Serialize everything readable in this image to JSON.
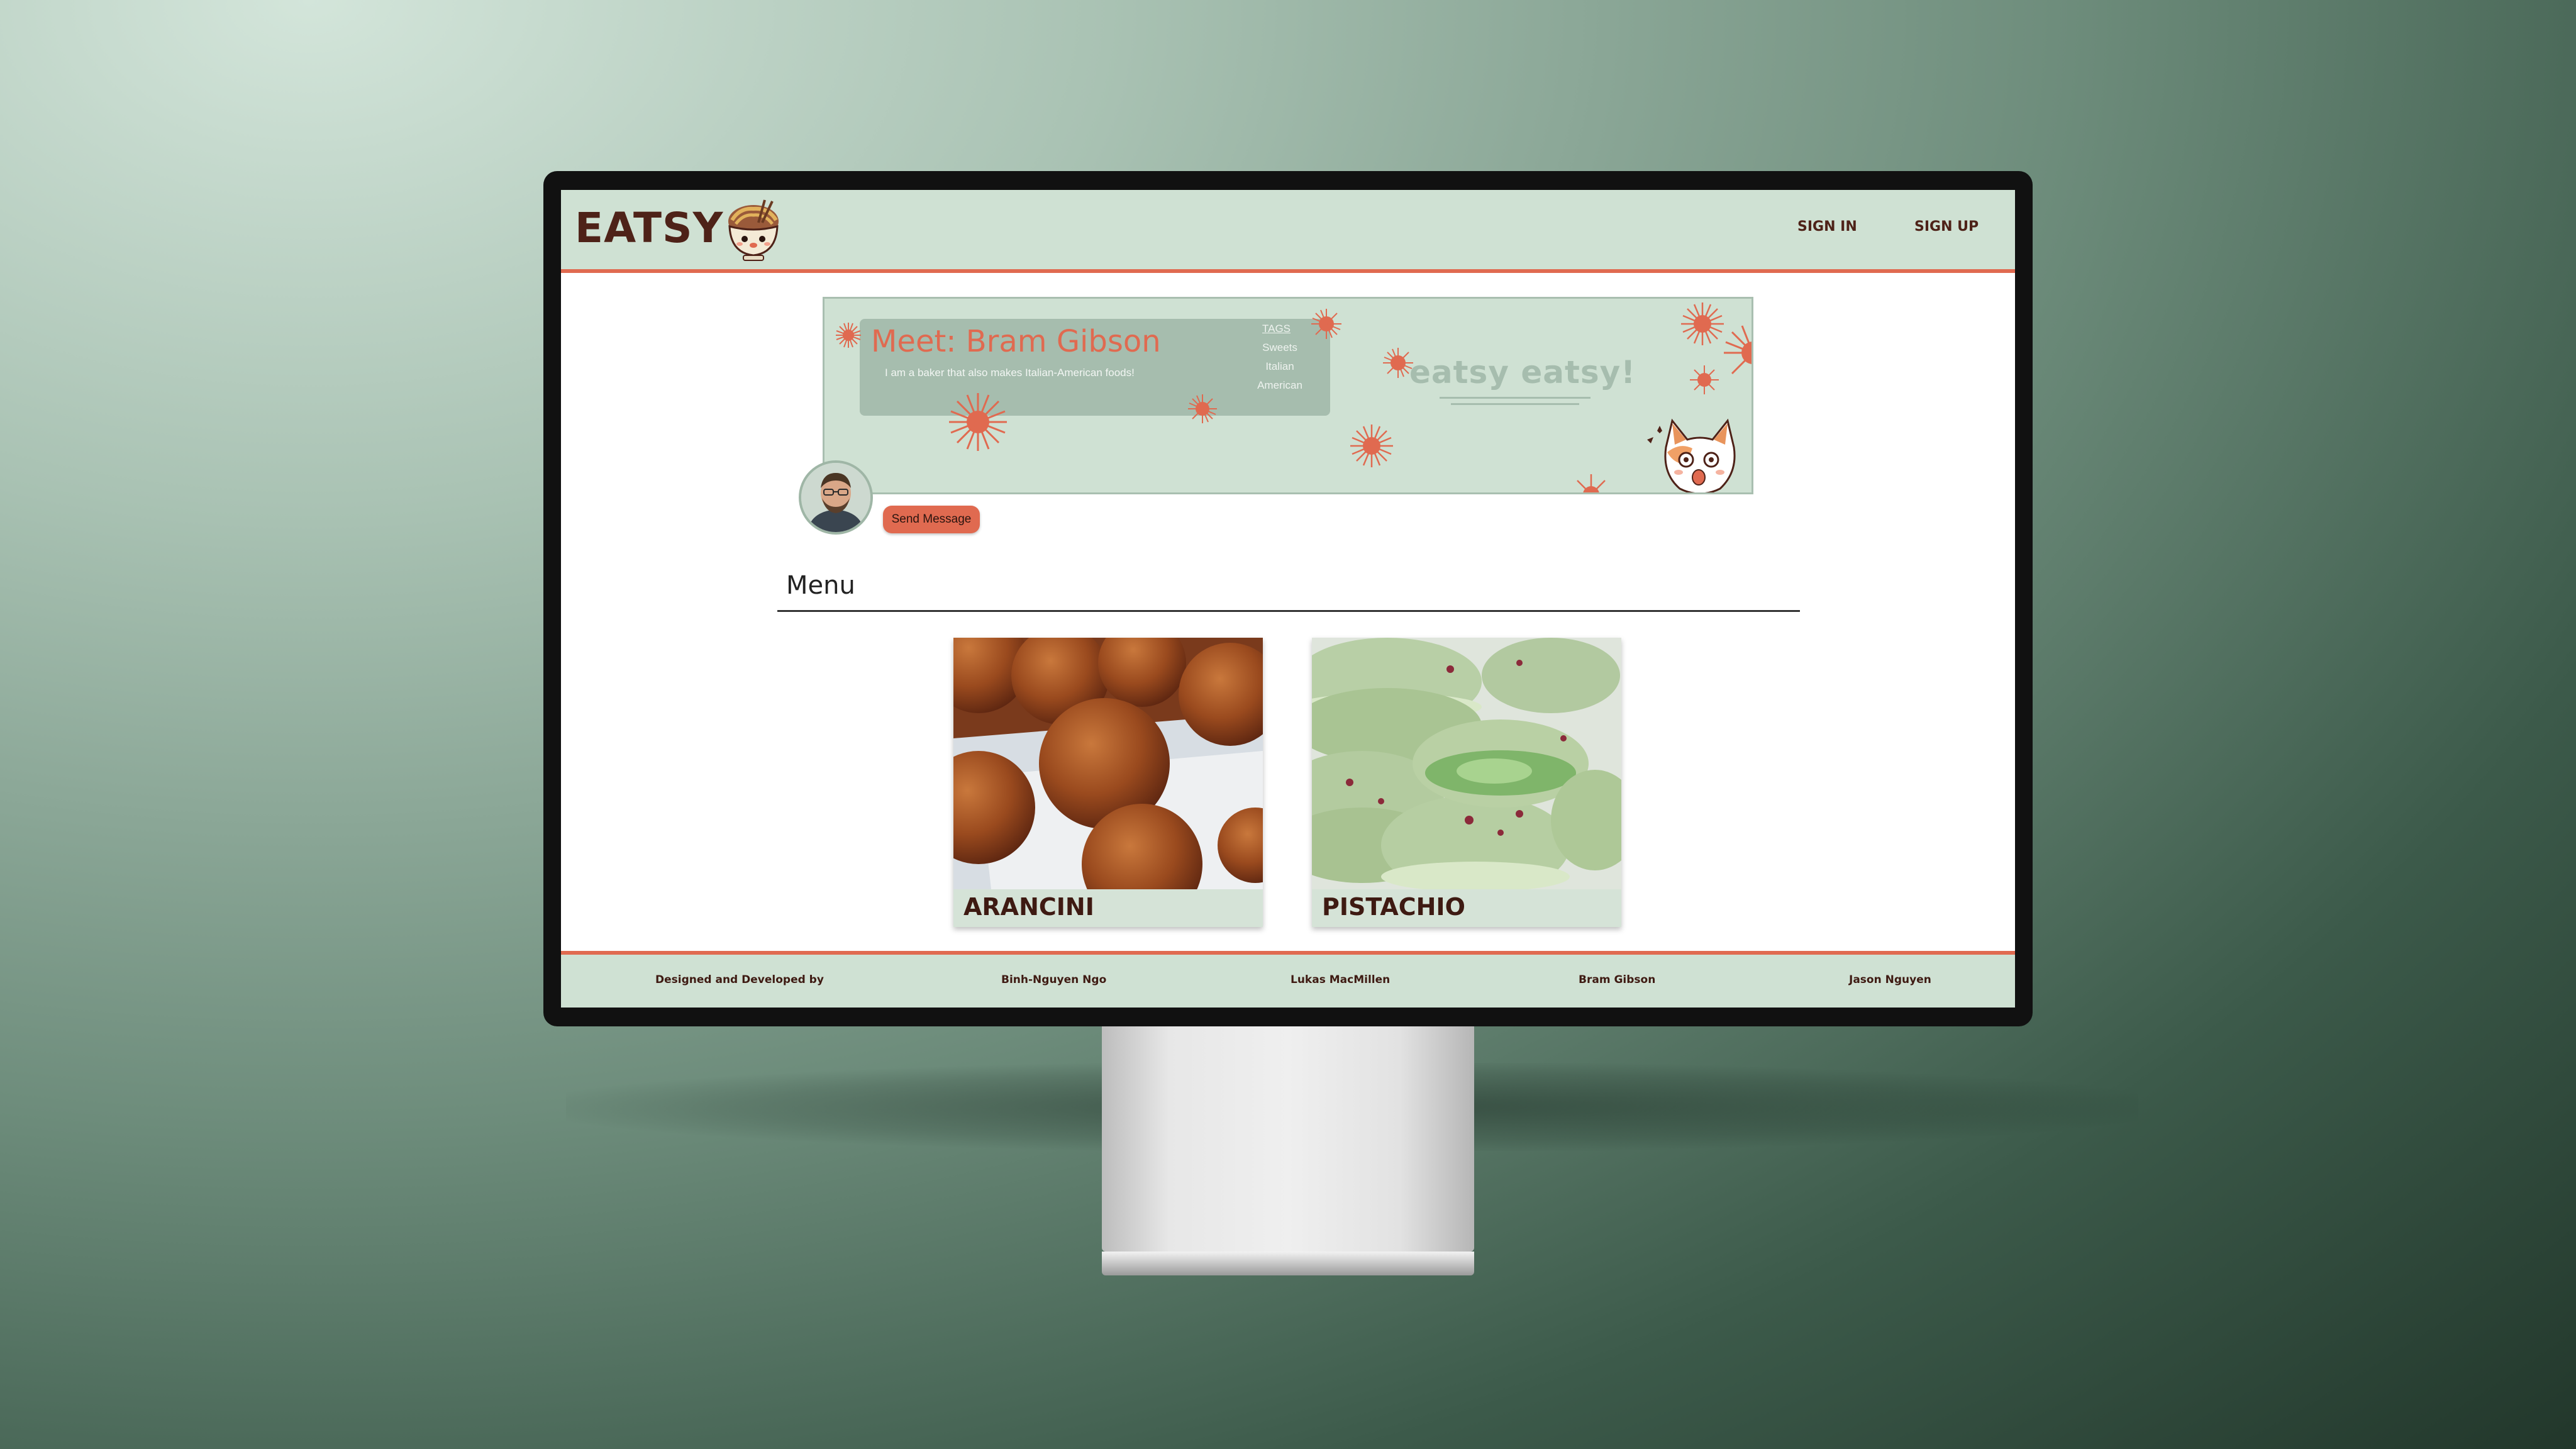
{
  "header": {
    "logo": "EATSY",
    "nav": {
      "sign_in": "SIGN IN",
      "sign_up": "SIGN UP"
    }
  },
  "profile": {
    "name": "Meet: Bram Gibson",
    "bio": "I am a baker that also makes Italian-American foods!",
    "tags_label": "TAGS",
    "tags": [
      "Sweets",
      "Italian",
      "American"
    ],
    "banner_text": "eatsy eatsy!",
    "send_message": "Send Message"
  },
  "menu": {
    "title": "Menu",
    "items": [
      {
        "name": "ARANCINI"
      },
      {
        "name": "PISTACHIO"
      }
    ]
  },
  "footer": {
    "credit": "Designed and Developed by",
    "developers": [
      "Binh-Nguyen Ngo",
      "Lukas MacMillen",
      "Bram Gibson",
      "Jason Nguyen"
    ]
  },
  "colors": {
    "accent": "#e06a50",
    "mint": "#cfe1d3",
    "brown": "#4e2218"
  }
}
